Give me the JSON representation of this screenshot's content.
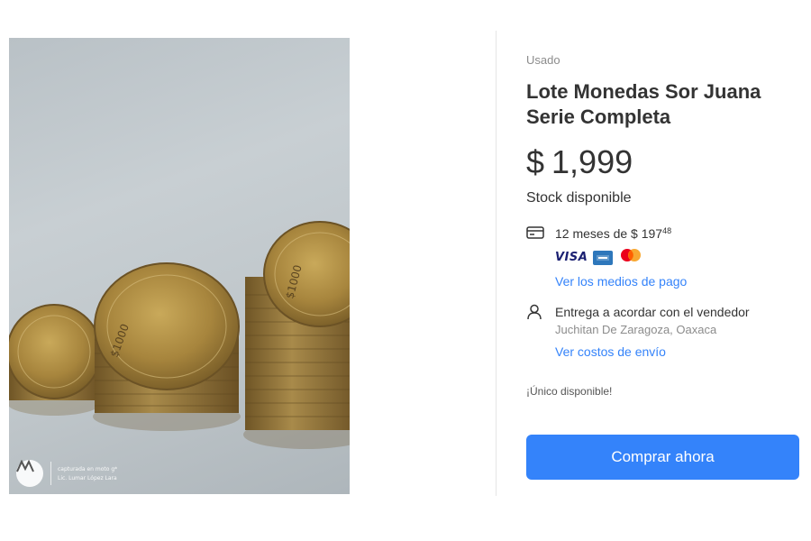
{
  "photo": {
    "watermark_line1": "capturada en moto g*",
    "watermark_line2": "Lic. Lumar López Lara"
  },
  "product": {
    "condition": "Usado",
    "title": "Lote Monedas Sor Juana Serie Completa",
    "price_symbol": "$",
    "price_value": "1,999",
    "stock": "Stock disponible"
  },
  "payment": {
    "installments_text": "12 meses de $ 197",
    "installments_cents": "48",
    "cards": [
      {
        "name": "VISA",
        "icon": "visa-icon"
      },
      {
        "name": "AMEX",
        "icon": "amex-icon"
      },
      {
        "name": "MASTERCARD",
        "icon": "mastercard-icon"
      }
    ],
    "link": "Ver los medios de pago"
  },
  "delivery": {
    "title": "Entrega a acordar con el vendedor",
    "location": "Juchitan De Zaragoza, Oaxaca",
    "link": "Ver costos de envío"
  },
  "availability": "¡Único disponible!",
  "buy_button": "Comprar ahora",
  "colors": {
    "accent": "#3483fa",
    "text": "#333333",
    "muted": "#8c8c8c"
  }
}
